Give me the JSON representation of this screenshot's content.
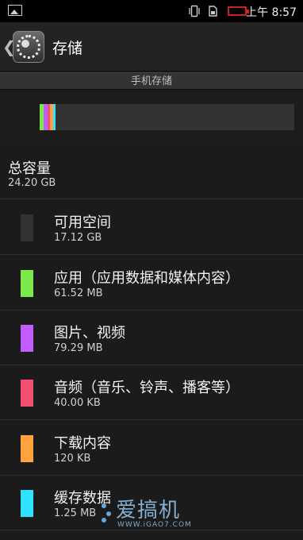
{
  "status_bar": {
    "icons": [
      "picture-icon",
      "vibrate-icon",
      "sim-icon",
      "battery-low-icon"
    ],
    "battery_color": "#d01f1f",
    "time": "上午 8:57"
  },
  "action_bar": {
    "title": "存储",
    "icon": "settings-gear-icon"
  },
  "section": {
    "header": "手机存储"
  },
  "storage_bar": {
    "segments": [
      {
        "color": "#7de84a",
        "fraction": 0.017
      },
      {
        "color": "#c15dff",
        "fraction": 0.013
      },
      {
        "color": "#f24f73",
        "fraction": 0.012
      },
      {
        "color": "#ffa43c",
        "fraction": 0.01
      },
      {
        "color": "#2fe3ff",
        "fraction": 0.011
      }
    ],
    "track_color": "#333333"
  },
  "total": {
    "title": "总容量",
    "value": "24.20 GB"
  },
  "categories": [
    {
      "label": "可用空间",
      "size": "17.12 GB",
      "color": "#333333"
    },
    {
      "label": "应用（应用数据和媒体内容）",
      "size": "61.52 MB",
      "color": "#7de84a"
    },
    {
      "label": "图片、视频",
      "size": "79.29 MB",
      "color": "#c15dff"
    },
    {
      "label": "音频（音乐、铃声、播客等）",
      "size": "40.00 KB",
      "color": "#f24f73"
    },
    {
      "label": "下载内容",
      "size": "120 KB",
      "color": "#ffa43c"
    },
    {
      "label": "缓存数据",
      "size": "1.25 MB",
      "color": "#2fe3ff"
    }
  ],
  "watermark": {
    "text": "爱搞机",
    "url": "WWW.iGAO7.COM"
  }
}
